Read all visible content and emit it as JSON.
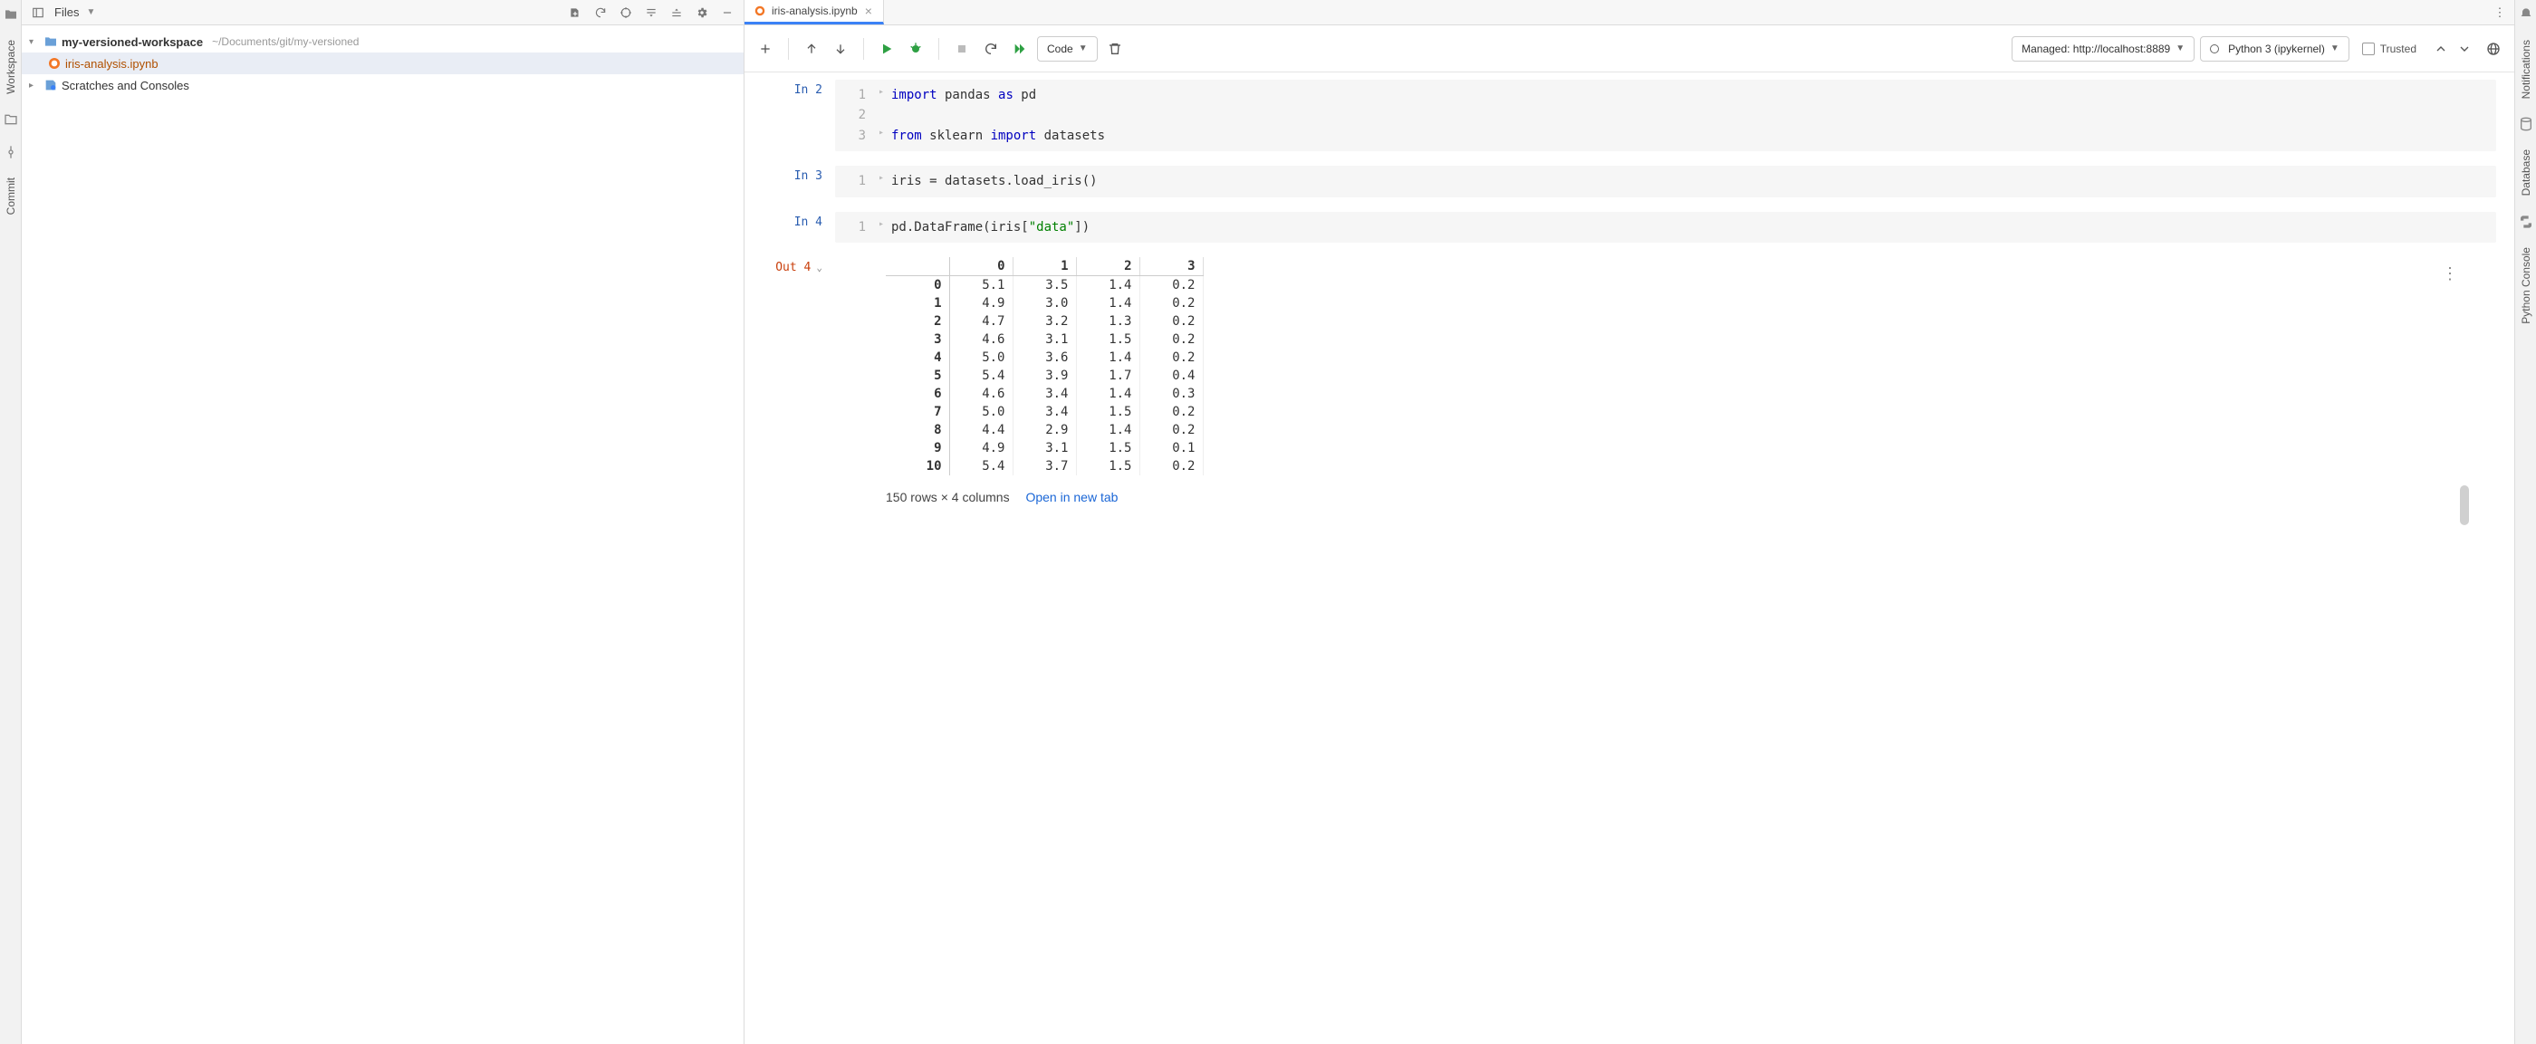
{
  "project_panel": {
    "title": "Files",
    "root": {
      "name": "my-versioned-workspace",
      "path": "~/Documents/git/my-versioned"
    },
    "items": [
      {
        "name": "iris-analysis.ipynb"
      }
    ],
    "scratches": "Scratches and Consoles"
  },
  "tab": {
    "name": "iris-analysis.ipynb"
  },
  "toolbar": {
    "cell_type": "Code",
    "managed": "Managed: http://localhost:8889",
    "kernel": "Python 3 (ipykernel)",
    "trusted": "Trusted"
  },
  "cells": [
    {
      "prompt": "In 2",
      "lines": [
        {
          "n": "1",
          "tokens": [
            [
              "kw",
              "import"
            ],
            [
              "",
              " pandas "
            ],
            [
              "kw",
              "as"
            ],
            [
              "",
              " pd"
            ]
          ]
        },
        {
          "n": "2",
          "tokens": [
            [
              "",
              ""
            ]
          ]
        },
        {
          "n": "3",
          "tokens": [
            [
              "kw",
              "from"
            ],
            [
              "",
              " sklearn "
            ],
            [
              "kw",
              "import"
            ],
            [
              "",
              " datasets"
            ]
          ]
        }
      ]
    },
    {
      "prompt": "In 3",
      "lines": [
        {
          "n": "1",
          "tokens": [
            [
              "",
              "iris = datasets.load_iris()"
            ]
          ]
        }
      ]
    },
    {
      "prompt": "In 4",
      "lines": [
        {
          "n": "1",
          "tokens": [
            [
              "",
              "pd.DataFrame(iris["
            ],
            [
              "str",
              "\"data\""
            ],
            [
              "",
              "])"
            ]
          ]
        }
      ]
    }
  ],
  "output": {
    "prompt": "Out 4",
    "columns": [
      "0",
      "1",
      "2",
      "3"
    ],
    "rows": [
      {
        "idx": "0",
        "v": [
          "5.1",
          "3.5",
          "1.4",
          "0.2"
        ]
      },
      {
        "idx": "1",
        "v": [
          "4.9",
          "3.0",
          "1.4",
          "0.2"
        ]
      },
      {
        "idx": "2",
        "v": [
          "4.7",
          "3.2",
          "1.3",
          "0.2"
        ]
      },
      {
        "idx": "3",
        "v": [
          "4.6",
          "3.1",
          "1.5",
          "0.2"
        ]
      },
      {
        "idx": "4",
        "v": [
          "5.0",
          "3.6",
          "1.4",
          "0.2"
        ]
      },
      {
        "idx": "5",
        "v": [
          "5.4",
          "3.9",
          "1.7",
          "0.4"
        ]
      },
      {
        "idx": "6",
        "v": [
          "4.6",
          "3.4",
          "1.4",
          "0.3"
        ]
      },
      {
        "idx": "7",
        "v": [
          "5.0",
          "3.4",
          "1.5",
          "0.2"
        ]
      },
      {
        "idx": "8",
        "v": [
          "4.4",
          "2.9",
          "1.4",
          "0.2"
        ]
      },
      {
        "idx": "9",
        "v": [
          "4.9",
          "3.1",
          "1.5",
          "0.1"
        ]
      },
      {
        "idx": "10",
        "v": [
          "5.4",
          "3.7",
          "1.5",
          "0.2"
        ]
      }
    ],
    "footer": "150 rows × 4 columns",
    "open_new": "Open in new tab"
  },
  "left_rail": {
    "workspace": "Workspace",
    "commit": "Commit"
  },
  "right_rail": {
    "notifications": "Notifications",
    "database": "Database",
    "py": "Python Console"
  }
}
